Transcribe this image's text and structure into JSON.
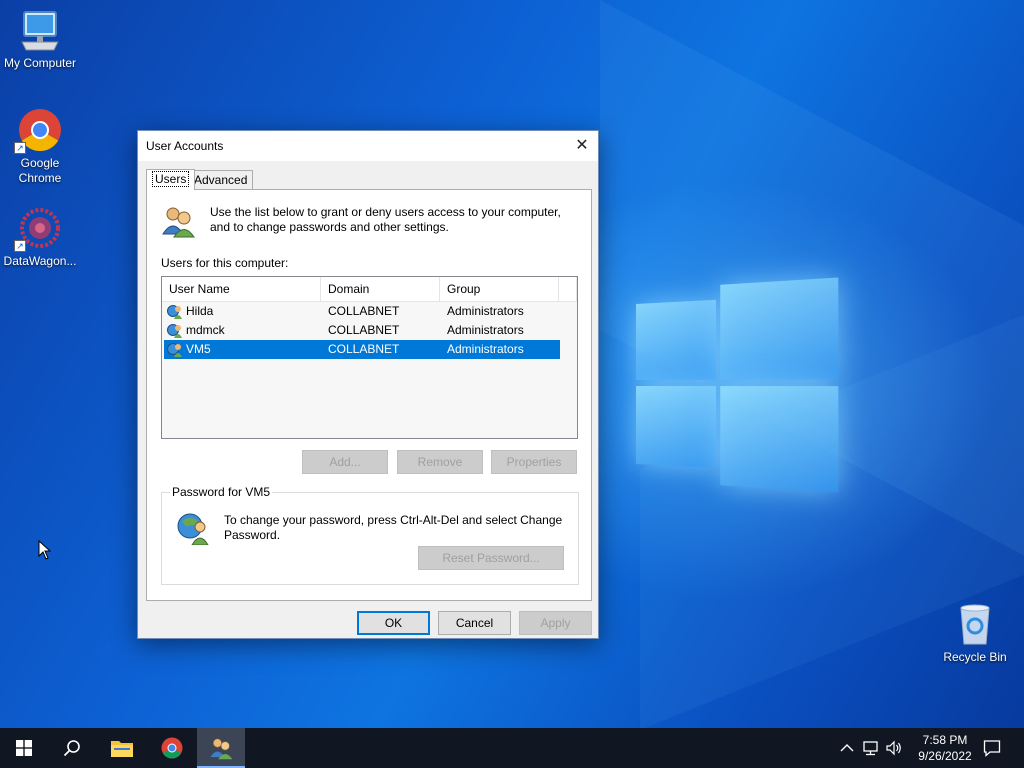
{
  "desktop": {
    "icons": [
      {
        "label": "My Computer"
      },
      {
        "label": "Google Chrome"
      },
      {
        "label": "DataWagon..."
      },
      {
        "label": "Recycle Bin"
      }
    ]
  },
  "dialog": {
    "title": "User Accounts",
    "close_glyph": "✕",
    "tabs": [
      {
        "label": "Users",
        "active": true
      },
      {
        "label": "Advanced",
        "active": false
      }
    ],
    "intro": "Use the list below to grant or deny users access to your computer, and to change passwords and other settings.",
    "users_label": "Users for this computer:",
    "columns": [
      "User Name",
      "Domain",
      "Group"
    ],
    "rows": [
      {
        "name": "Hilda",
        "domain": "COLLABNET",
        "group": "Administrators",
        "selected": false
      },
      {
        "name": "mdmck",
        "domain": "COLLABNET",
        "group": "Administrators",
        "selected": false
      },
      {
        "name": "VM5",
        "domain": "COLLABNET",
        "group": "Administrators",
        "selected": true
      }
    ],
    "buttons": {
      "add": "Add...",
      "remove": "Remove",
      "properties": "Properties",
      "reset_password": "Reset Password...",
      "ok": "OK",
      "cancel": "Cancel",
      "apply": "Apply"
    },
    "password_group": {
      "legend": "Password for VM5",
      "text": "To change your password, press Ctrl-Alt-Del and select Change Password."
    }
  },
  "taskbar": {
    "icons": [
      "start-icon",
      "search-icon",
      "file-explorer-icon",
      "chrome-icon",
      "user-accounts-icon"
    ],
    "clock": {
      "time": "7:58 PM",
      "date": "9/26/2022"
    }
  },
  "colors": {
    "accent": "#0078d7",
    "taskbar": "#101622"
  }
}
